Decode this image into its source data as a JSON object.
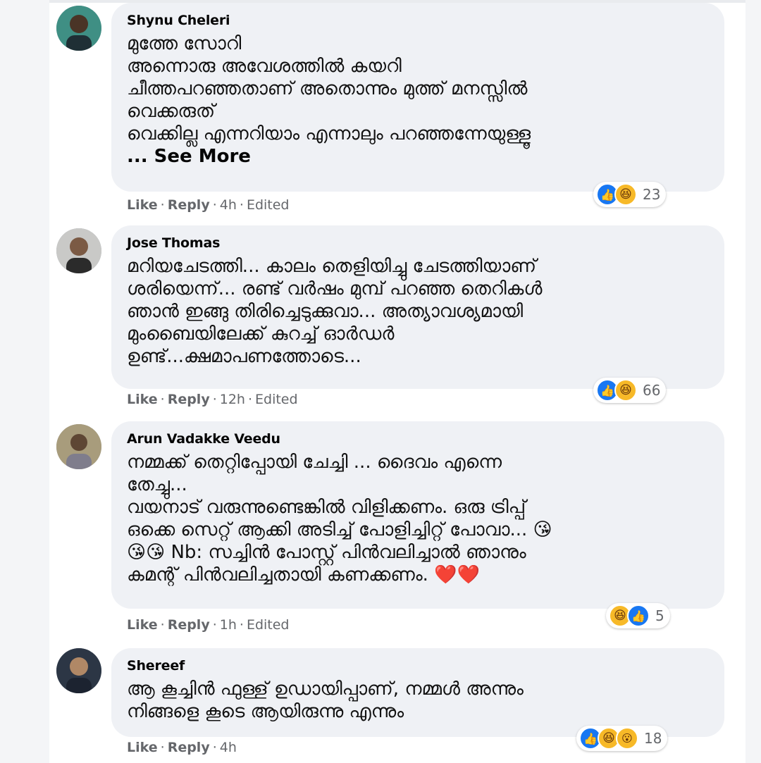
{
  "comments": [
    {
      "author": "Shynu Cheleri",
      "text": "മുത്തേ സോറി\nഅന്നൊരു അവേശത്തിൽ കയറി\nചീത്തപറഞ്ഞതാണ് അതൊന്നും മുത്ത് മനസ്സിൽ\nവെക്കരുത്\nവെക്കില്ല എന്നറിയാം എന്നാലും പറഞ്ഞന്നേയുള്ളൂ",
      "see_more": "... See More",
      "reactions": [
        "like-icon",
        "haha-icon"
      ],
      "reaction_count": "23",
      "like_label": "Like",
      "reply_label": "Reply",
      "time": "4h",
      "edited": "Edited"
    },
    {
      "author": "Jose Thomas",
      "text": "മറിയചേടത്തി... കാലം തെളിയിച്ചു ചേടത്തിയാണ്\nശരിയെന്ന്... രണ്ട് വർഷം മുമ്പ് പറഞ്ഞ തെറികൾ\nഞാൻ ഇങ്ങു തിരിച്ചെടുക്കുവാ... അത്യാവശ്യമായി\nമുംബൈയിലേക്ക് കുറച്ച് ഓർഡർ\nഉണ്ട്...ക്ഷമാപണത്തോടെ...",
      "reactions": [
        "like-icon",
        "haha-icon"
      ],
      "reaction_count": "66",
      "like_label": "Like",
      "reply_label": "Reply",
      "time": "12h",
      "edited": "Edited"
    },
    {
      "author": "Arun Vadakke Veedu",
      "text": "നമ്മക്ക് തെറ്റിപ്പോയി ചേച്ചി ... ദൈവം എന്നെ\nതേച്ചു...\nവയനാട് വരുന്നുണ്ടെങ്കിൽ വിളിക്കണം. ഒരു ട്രിപ്പ്\nഒക്കെ സെറ്റ് ആക്കി അടിച്ച് പോളിച്ചിറ്റ് പോവാ... 😘\n😘😘 Nb: സച്ചിൻ പോസ്റ്റ് പിൻവലിച്ചാൽ ഞാനും\nകമന്റ് പിൻവലിച്ചതായി കണക്കണം. ❤️❤️",
      "reactions": [
        "haha-icon",
        "like-icon"
      ],
      "reaction_count": "5",
      "like_label": "Like",
      "reply_label": "Reply",
      "time": "1h",
      "edited": "Edited"
    },
    {
      "author": "Shereef",
      "text": "ആ കൂച്ചിൻ ഫുള്ള് ഉഡായിപ്പാണ്, നമ്മൾ അന്നും\nനിങ്ങളെ കൂടെ ആയിരുന്നു എന്നും",
      "reactions": [
        "like-icon",
        "haha-icon",
        "wow-icon"
      ],
      "reaction_count": "18",
      "like_label": "Like",
      "reply_label": "Reply",
      "time": "4h"
    }
  ],
  "separator": "·",
  "colors": {
    "bubble": "#eff1f5",
    "meta": "#65676b",
    "like": "#1877f2",
    "haha": "#f7b928",
    "heart": "#e41e3f"
  }
}
